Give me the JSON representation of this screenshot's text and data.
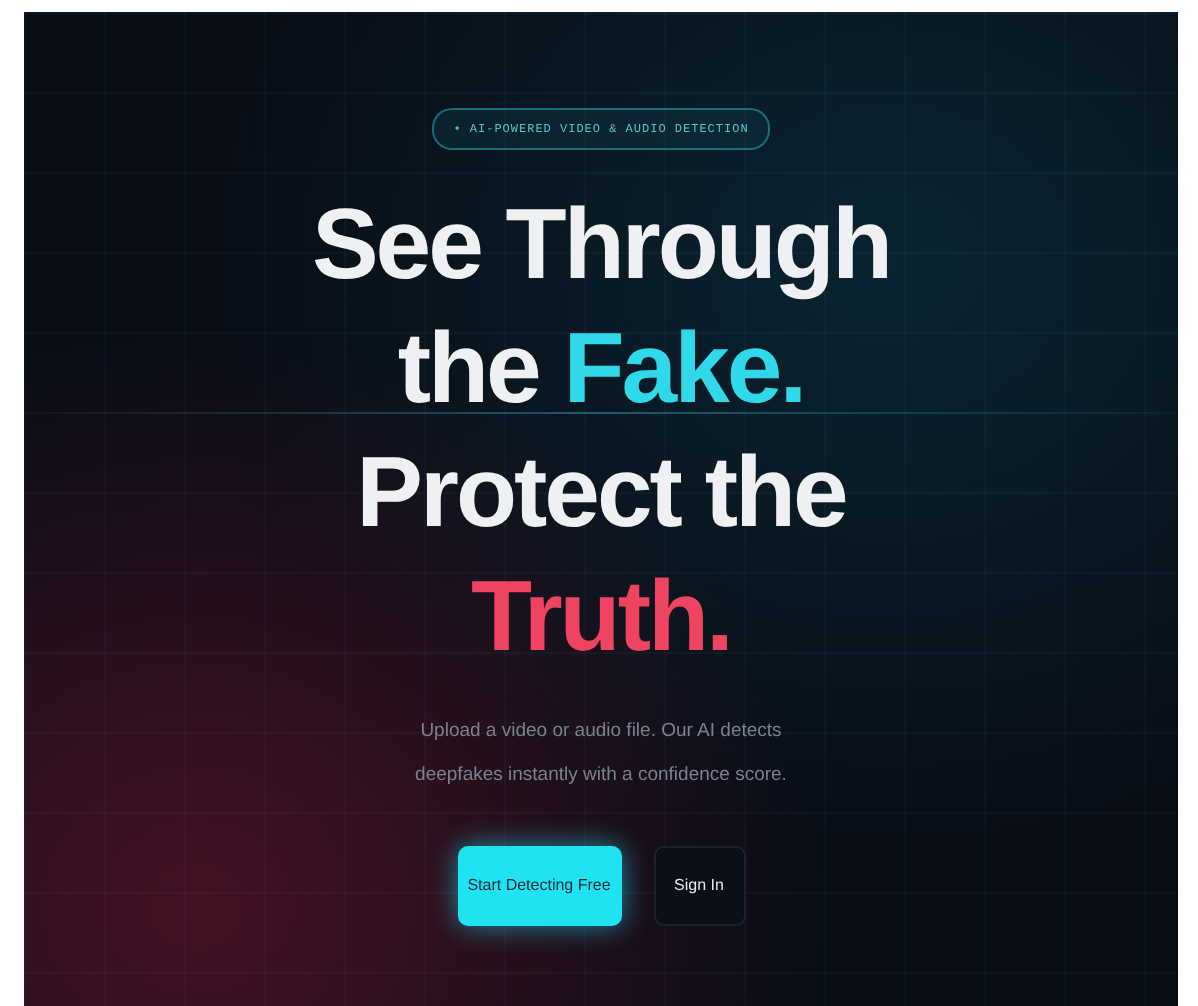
{
  "badge": "• AI-POWERED VIDEO & AUDIO DETECTION",
  "headline": [
    [
      {
        "text": "See Through",
        "kind": "plain"
      }
    ],
    [
      {
        "text": "the ",
        "kind": "plain"
      },
      {
        "text": "Fake.",
        "kind": "cyan"
      }
    ],
    [
      {
        "text": "Protect the",
        "kind": "plain"
      }
    ],
    [
      {
        "text": "Truth.",
        "kind": "red"
      }
    ]
  ],
  "description": "Upload a video or audio file. Our AI detects deepfakes instantly with a confidence score.",
  "buttons": [
    {
      "label": "Start Detecting Free",
      "kind": "primary"
    },
    {
      "label": "Sign In",
      "kind": "outline"
    }
  ]
}
